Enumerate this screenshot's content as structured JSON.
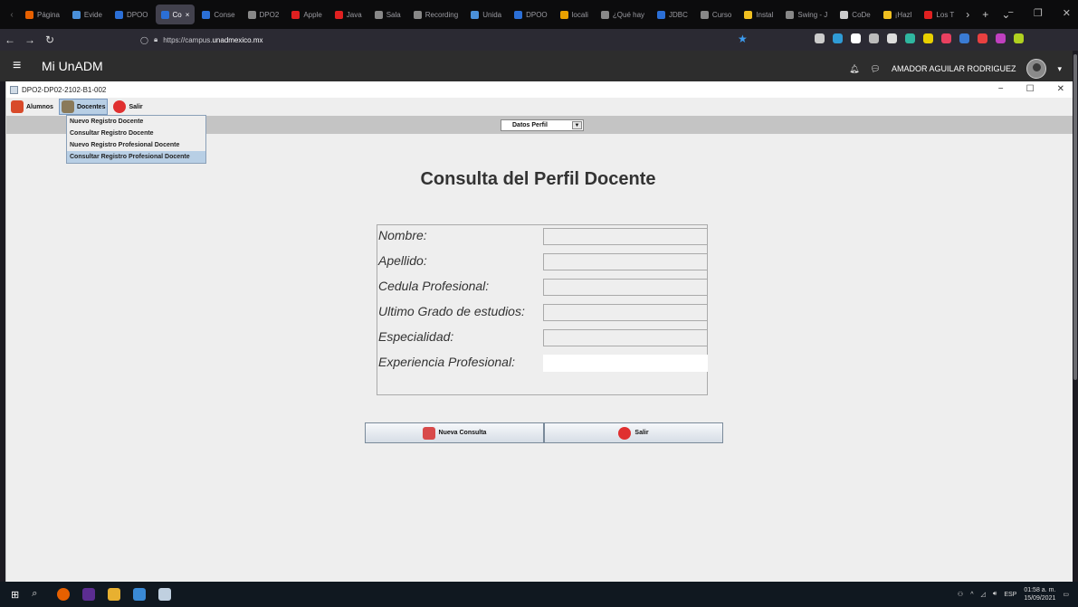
{
  "browser": {
    "tabs": [
      {
        "label": "Página",
        "color": "#e66000",
        "active": false
      },
      {
        "label": "Evide",
        "color": "#4a90d9",
        "active": false
      },
      {
        "label": "DPOO",
        "color": "#2b6fd6",
        "active": false
      },
      {
        "label": "Co",
        "color": "#2b6fd6",
        "active": true
      },
      {
        "label": "Conse",
        "color": "#2b6fd6",
        "active": false
      },
      {
        "label": "DPO2",
        "color": "#888",
        "active": false
      },
      {
        "label": "Apple",
        "color": "#e02020",
        "active": false
      },
      {
        "label": "Java",
        "color": "#e02020",
        "active": false
      },
      {
        "label": "Sala",
        "color": "#888",
        "active": false
      },
      {
        "label": "Recording",
        "color": "#888",
        "active": false
      },
      {
        "label": "Unida",
        "color": "#4a90d9",
        "active": false
      },
      {
        "label": "DPOO",
        "color": "#2b6fd6",
        "active": false
      },
      {
        "label": "locali",
        "color": "#e8a000",
        "active": false
      },
      {
        "label": "¿Qué hay",
        "color": "#888",
        "active": false
      },
      {
        "label": "JDBC",
        "color": "#2b6fd6",
        "active": false
      },
      {
        "label": "Curso",
        "color": "#888",
        "active": false
      },
      {
        "label": "Instal",
        "color": "#f0c020",
        "active": false
      },
      {
        "label": "Swing - J",
        "color": "#888",
        "active": false
      },
      {
        "label": "CoDe",
        "color": "#cccccc",
        "active": false
      },
      {
        "label": "¡Hazl",
        "color": "#f0c020",
        "active": false
      },
      {
        "label": "Los T",
        "color": "#e02020",
        "active": false
      }
    ],
    "tab_close": "×",
    "url_prefix": "https://campus.",
    "url_domain": "unadmexico.mx",
    "ext_colors": [
      "#cccccc",
      "#2f9bd6",
      "#ffffff",
      "#bbbbbb",
      "#dddddd",
      "#2fb6a0",
      "#e8d000",
      "#e84060",
      "#3a7bd5",
      "#e84040",
      "#c040c0",
      "#b0d020"
    ]
  },
  "site": {
    "brand": "Mi UnADM",
    "user_name": "AMADOR AGUILAR RODRIGUEZ"
  },
  "app": {
    "window_title": "DPO2-DP02-2102-B1-002",
    "menus": {
      "alumnos": "Alumnos",
      "docentes": "Docentes",
      "salir": "Salir"
    },
    "dropdown_items": [
      "Nuevo Registro Docente",
      "Consultar Registro Docente",
      "Nuevo Registro Profesional Docente",
      "Consultar Registro Profesional Docente"
    ],
    "combo_value": "Datos Perfil",
    "form_title": "Consulta del Perfil Docente",
    "fields": {
      "nombre": {
        "label": "Nombre:",
        "value": ""
      },
      "apellido": {
        "label": "Apellido:",
        "value": ""
      },
      "cedula": {
        "label": "Cedula Profesional:",
        "value": ""
      },
      "grado": {
        "label": "Ultimo Grado de estudios:",
        "value": ""
      },
      "especialidad": {
        "label": "Especialidad:",
        "value": ""
      },
      "experiencia": {
        "label": "Experiencia Profesional:",
        "value": ""
      }
    },
    "buttons": {
      "nueva_consulta": "Nueva Consulta",
      "salir": "Salir"
    }
  },
  "taskbar": {
    "language": "ESP",
    "time": "01:58 a. m.",
    "date": "15/09/2021"
  }
}
